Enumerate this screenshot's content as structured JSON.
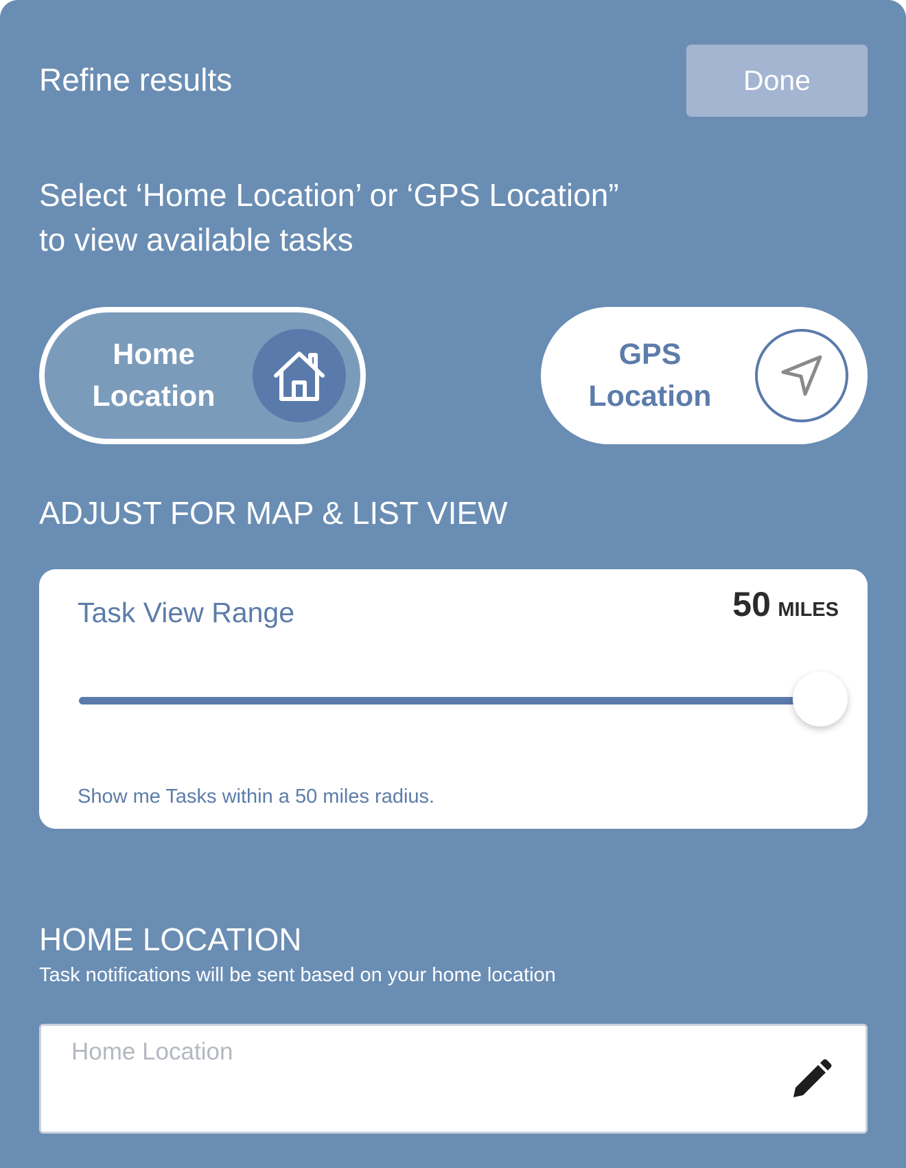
{
  "header": {
    "title": "Refine results",
    "done_label": "Done"
  },
  "instruction": {
    "line1": "Select ‘Home Location’ or ‘GPS Location”",
    "line2": "to view available tasks"
  },
  "location_toggle": {
    "selected": "home",
    "home": {
      "line1": "Home",
      "line2": "Location",
      "icon": "house-icon"
    },
    "gps": {
      "line1": "GPS",
      "line2": "Location",
      "icon": "navigation-arrow-icon"
    }
  },
  "map_list_section": {
    "heading": "ADJUST FOR MAP & LIST VIEW"
  },
  "range": {
    "title": "Task View Range",
    "value": "50",
    "unit": "MILES",
    "slider_fraction": 1.0,
    "caption": "Show me Tasks within a 50 miles radius."
  },
  "home_location": {
    "heading": "HOME LOCATION",
    "subtext": "Task notifications will be sent based on your home location",
    "placeholder": "Home Location",
    "value": ""
  },
  "colors": {
    "background": "#6a8db3",
    "accent": "#5a7aab",
    "done_button": "#a3b5d1",
    "card": "#ffffff"
  }
}
